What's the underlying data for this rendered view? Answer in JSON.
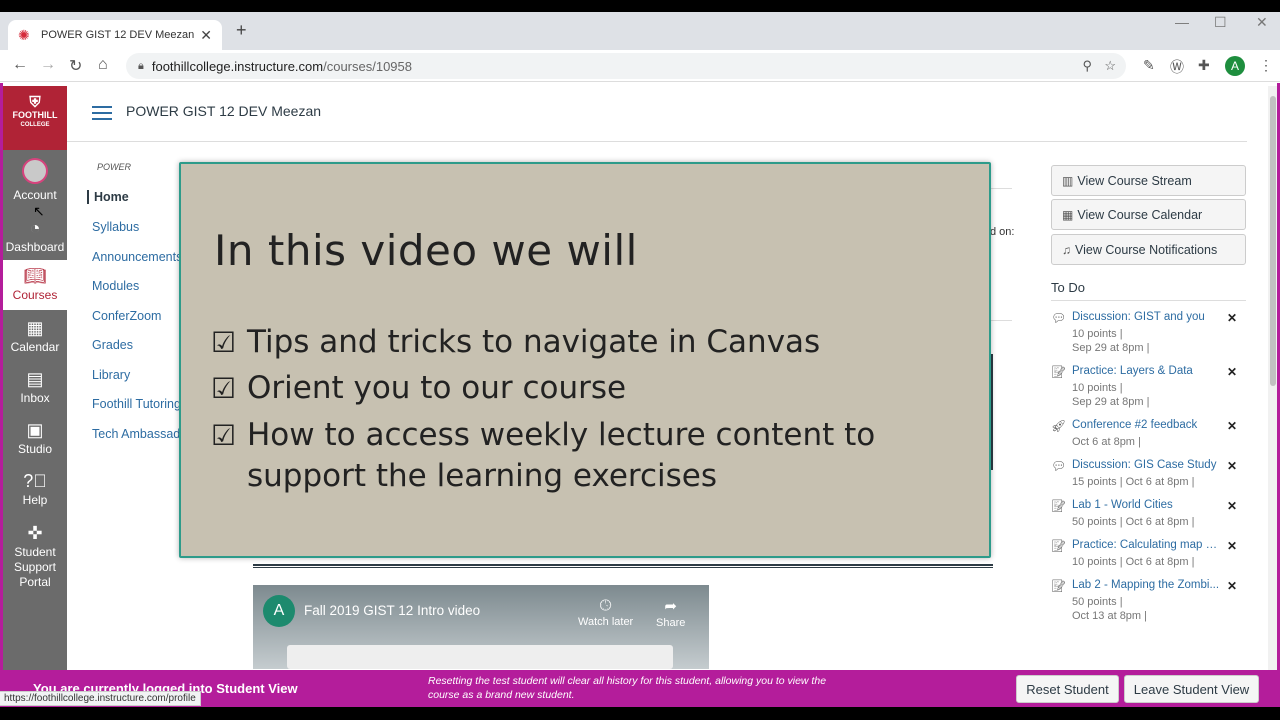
{
  "browser": {
    "tab_title": "POWER GIST 12 DEV Meezan",
    "url_host": "foothillcollege.instructure.com",
    "url_path": "/courses/10958",
    "profile_initial": "A",
    "status_url": "https://foothillcollege.instructure.com/profile"
  },
  "global_nav": {
    "logo_line1": "FOOTHILL",
    "logo_line2": "COLLEGE",
    "items": [
      {
        "label": "Account",
        "icon": "user-avatar"
      },
      {
        "label": "Dashboard",
        "icon": "dashboard-icon"
      },
      {
        "label": "Courses",
        "icon": "courses-icon"
      },
      {
        "label": "Calendar",
        "icon": "calendar-icon"
      },
      {
        "label": "Inbox",
        "icon": "inbox-icon"
      },
      {
        "label": "Studio",
        "icon": "studio-icon"
      },
      {
        "label": "Help",
        "icon": "help-icon"
      },
      {
        "label": "Student Support Portal",
        "icon": "support-icon"
      }
    ]
  },
  "header": {
    "breadcrumb": "POWER GIST 12 DEV Meezan"
  },
  "course_nav": {
    "label": "POWER",
    "items": [
      "Home",
      "Syllabus",
      "Announcements",
      "Modules",
      "ConferZoom",
      "Grades",
      "Library",
      "Foothill Tutoring",
      "Tech Ambassadors"
    ]
  },
  "main": {
    "partial_label": "d on:"
  },
  "overlay": {
    "title": "In this video we will",
    "checkbox": "☑",
    "items": [
      "Tips and tricks to navigate in Canvas",
      "Orient you to our course",
      "How to access weekly lecture content to support the learning exercises"
    ]
  },
  "video": {
    "channel_initial": "A",
    "title": "Fall 2019 GIST 12 Intro video",
    "watch_later": "Watch later",
    "share": "Share"
  },
  "right_sidebar": {
    "buttons": [
      "View Course Stream",
      "View Course Calendar",
      "View Course Notifications"
    ],
    "todo_title": "To Do",
    "todos": [
      {
        "title": "Discussion: GIST and you",
        "meta1": "10 points  |",
        "meta2": "Sep 29 at 8pm  |",
        "icon": "discussion-icon"
      },
      {
        "title": "Practice: Layers & Data",
        "meta1": "10 points  |",
        "meta2": "Sep 29 at 8pm  |",
        "icon": "assignment-icon"
      },
      {
        "title": "Conference #2 feedback",
        "meta1": "Oct 6 at 8pm  |",
        "meta2": "",
        "icon": "quiz-icon"
      },
      {
        "title": "Discussion: GIS Case Study",
        "meta1": "15 points  |  Oct 6 at 8pm  |",
        "meta2": "",
        "icon": "discussion-icon"
      },
      {
        "title": "Lab 1 - World Cities",
        "meta1": "50 points  |  Oct 6 at 8pm  |",
        "meta2": "",
        "icon": "assignment-icon"
      },
      {
        "title": "Practice: Calculating map s...",
        "meta1": "10 points  |  Oct 6 at 8pm  |",
        "meta2": "",
        "icon": "assignment-icon"
      },
      {
        "title": "Lab 2 - Mapping the Zombi...",
        "meta1": "50 points  |",
        "meta2": "Oct 13 at 8pm  |",
        "icon": "assignment-icon"
      }
    ],
    "dismiss": "✕"
  },
  "student_view": {
    "banner": "You are currently logged into Student View",
    "note": "Resetting the test student will clear all history for this student, allowing you to view the course as a brand new student.",
    "reset": "Reset Student",
    "leave": "Leave Student View"
  },
  "colors": {
    "student_bar": "#b41d9b",
    "brand_red": "#b02336",
    "link": "#2d6ca2",
    "overlay_bg": "#c7c1b1"
  }
}
